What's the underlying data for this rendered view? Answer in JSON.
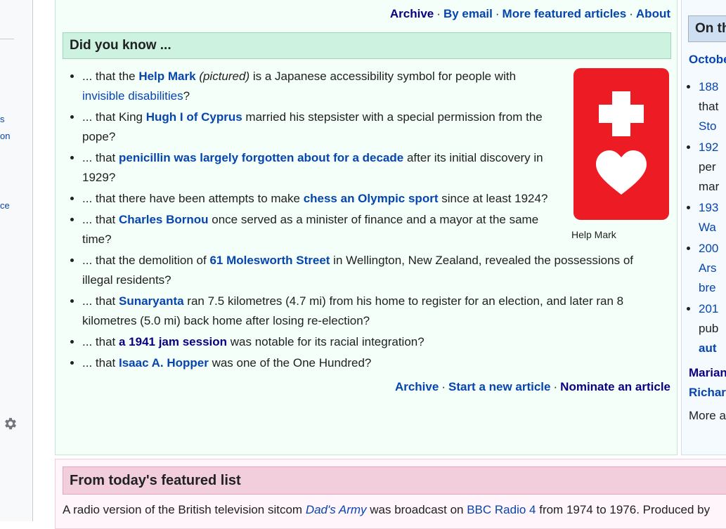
{
  "left_sidebar": {
    "fragments": [
      "s",
      "on",
      "ce"
    ],
    "settings_icon": "gear-icon"
  },
  "dyk": {
    "top_links": [
      "Archive",
      "By email",
      "More featured articles",
      "About"
    ],
    "separator": "·",
    "heading": "Did you know ...",
    "items": [
      {
        "parts": [
          {
            "t": "... that the "
          },
          {
            "t": "Help Mark",
            "link": true,
            "bold": true
          },
          {
            "t": " "
          },
          {
            "t": "(pictured)",
            "italic": true
          },
          {
            "t": " is a Japanese accessibility symbol for people with "
          },
          {
            "t": "invisible disabilities",
            "link": true
          },
          {
            "t": "?"
          }
        ]
      },
      {
        "parts": [
          {
            "t": "... that King "
          },
          {
            "t": "Hugh I of Cyprus",
            "link": true,
            "bold": true
          },
          {
            "t": " married his stepsister with a special permission from the pope?"
          }
        ]
      },
      {
        "parts": [
          {
            "t": "... that "
          },
          {
            "t": "penicillin was largely forgotten about for a decade",
            "link": true,
            "bold": true
          },
          {
            "t": " after its initial discovery in 1929?"
          }
        ]
      },
      {
        "parts": [
          {
            "t": "... that there have been attempts to make "
          },
          {
            "t": "chess an Olympic sport",
            "link": true,
            "bold": true
          },
          {
            "t": " since at least 1924?"
          }
        ]
      },
      {
        "parts": [
          {
            "t": "... that "
          },
          {
            "t": "Charles Bornou",
            "link": true,
            "bold": true
          },
          {
            "t": " once served as a minister of finance and a mayor at the same time?"
          }
        ]
      },
      {
        "parts": [
          {
            "t": "... that the demolition of "
          },
          {
            "t": "61 Molesworth Street",
            "link": true,
            "bold": true
          },
          {
            "t": " in Wellington, New Zealand, revealed the possessions of illegal residents?"
          }
        ]
      },
      {
        "parts": [
          {
            "t": "... that "
          },
          {
            "t": "Sunaryanta",
            "link": true,
            "bold": true
          },
          {
            "t": " ran 7.5 kilometres (4.7 mi) from his home to register for an election, and later ran 8 kilometres (5.0 mi) back home after losing re-election?"
          }
        ]
      },
      {
        "parts": [
          {
            "t": "... that "
          },
          {
            "t": "a 1941 jam session",
            "link": true,
            "bold": true,
            "visited": true
          },
          {
            "t": " was notable for its racial integration?"
          }
        ]
      },
      {
        "parts": [
          {
            "t": "... that "
          },
          {
            "t": "Isaac A. Hopper",
            "link": true,
            "bold": true
          },
          {
            "t": " was one of the One Hundred?"
          }
        ]
      }
    ],
    "image_caption": "Help Mark",
    "image_icon": "help-mark-icon",
    "bottom_links": [
      "Archive",
      "Start a new article",
      "Nominate an article"
    ]
  },
  "otd": {
    "heading": "On th",
    "date": "Octobe",
    "items": [
      [
        "188",
        "that",
        "Sto"
      ],
      [
        "192",
        "per",
        "mar"
      ],
      [
        "193",
        "Wa"
      ],
      [
        "200",
        "Ars",
        "bre"
      ],
      [
        "201",
        "pub",
        "aut"
      ]
    ],
    "people": [
      "Marian",
      "Richar"
    ],
    "more": "More a"
  },
  "tfl": {
    "heading": "From today's featured list",
    "text_parts": [
      {
        "t": "A radio version of the British television sitcom "
      },
      {
        "t": "Dad's Army",
        "link": true,
        "italic": true
      },
      {
        "t": " was broadcast on "
      },
      {
        "t": "BBC Radio 4",
        "link": true
      },
      {
        "t": " from 1974 to 1976. Produced by"
      }
    ]
  },
  "colors": {
    "link": "#0645ad",
    "visited_link": "#0b0080",
    "help_mark_red": "#ed1c24",
    "dyk_bg": "#f5fffa",
    "dyk_header_bg": "#cef2e0",
    "tfl_header_bg": "#f2cedd"
  }
}
